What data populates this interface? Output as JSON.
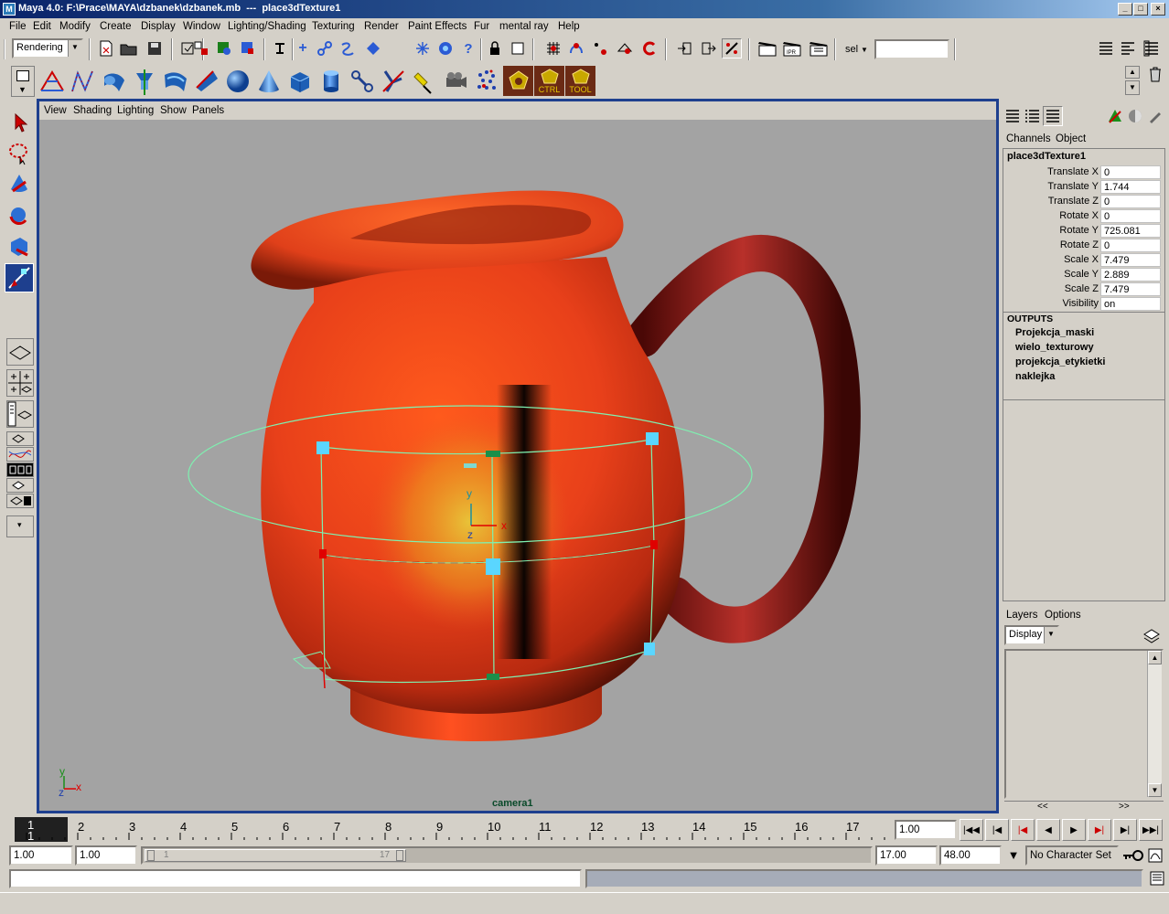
{
  "window": {
    "title": "Maya 4.0: F:\\Prace\\MAYA\\dzbanek\\dzbanek.mb  ---  place3dTexture1"
  },
  "menubar": [
    "File",
    "Edit",
    "Modify",
    "Create",
    "Display",
    "Window",
    "Lighting/Shading",
    "Texturing",
    "Render",
    "Paint Effects",
    "Fur",
    "mental ray",
    "Help"
  ],
  "statusline": {
    "menu_set": "Rendering",
    "select_field_label": "sel",
    "select_field_value": ""
  },
  "shelf": {
    "icons": [
      "nurbs-curve-icon",
      "cv-curve-icon",
      "nurbs-cylinder-icon",
      "revolve-icon",
      "loft-icon",
      "planar-icon",
      "sphere-icon",
      "cone-icon",
      "cube-icon",
      "cylinder-icon",
      "joint-icon",
      "ik-handle-icon",
      "light-icon",
      "camera-icon",
      "particles-icon",
      "hotbox-icon",
      "ctrl-icon",
      "tool-icon"
    ],
    "ctrl_label": "CTRL",
    "tool_label": "TOOL"
  },
  "viewport": {
    "menu": [
      "View",
      "Shading",
      "Lighting",
      "Show",
      "Panels"
    ],
    "camera_label": "camera1",
    "manip_axis_y": "y",
    "manip_axis_x": "x",
    "manip_axis_z": "z",
    "axes_y": "y",
    "axes_x": "x",
    "axes_z": "z",
    "colors": {
      "background": "#a3a3a3",
      "jug": "#e8461b",
      "handle": "#8a1a12",
      "manip": "#7ff0b0"
    }
  },
  "channelbox": {
    "tabs": [
      "Channels",
      "Object"
    ],
    "node_name": "place3dTexture1",
    "attributes": [
      {
        "label": "Translate X",
        "value": "0"
      },
      {
        "label": "Translate Y",
        "value": "1.744"
      },
      {
        "label": "Translate Z",
        "value": "0"
      },
      {
        "label": "Rotate X",
        "value": "0"
      },
      {
        "label": "Rotate Y",
        "value": "725.081"
      },
      {
        "label": "Rotate Z",
        "value": "0"
      },
      {
        "label": "Scale X",
        "value": "7.479"
      },
      {
        "label": "Scale Y",
        "value": "2.889"
      },
      {
        "label": "Scale Z",
        "value": "7.479"
      },
      {
        "label": "Visibility",
        "value": "on"
      }
    ],
    "outputs_label": "OUTPUTS",
    "outputs": [
      "Projekcja_maski",
      "wielo_texturowy",
      "projekcja_etykietki",
      "naklejka"
    ]
  },
  "layers": {
    "menu": [
      "Layers",
      "Options"
    ],
    "display_value": "Display",
    "scroll_left": "<<",
    "scroll_right": ">>"
  },
  "timeslider": {
    "ticks": [
      "1",
      "2",
      "3",
      "4",
      "5",
      "6",
      "7",
      "8",
      "9",
      "10",
      "11",
      "12",
      "13",
      "14",
      "15",
      "16",
      "17"
    ],
    "current_frame_top": "1",
    "current_frame_bottom": "1",
    "current_time": "1.00"
  },
  "rangeslider": {
    "start_time": "1.00",
    "playback_start": "1.00",
    "range_start_label": "1",
    "range_end_label": "17",
    "playback_end": "17.00",
    "end_time": "48.00",
    "character_set": "No Character Set"
  },
  "commandline": {
    "value": "",
    "result": ""
  }
}
